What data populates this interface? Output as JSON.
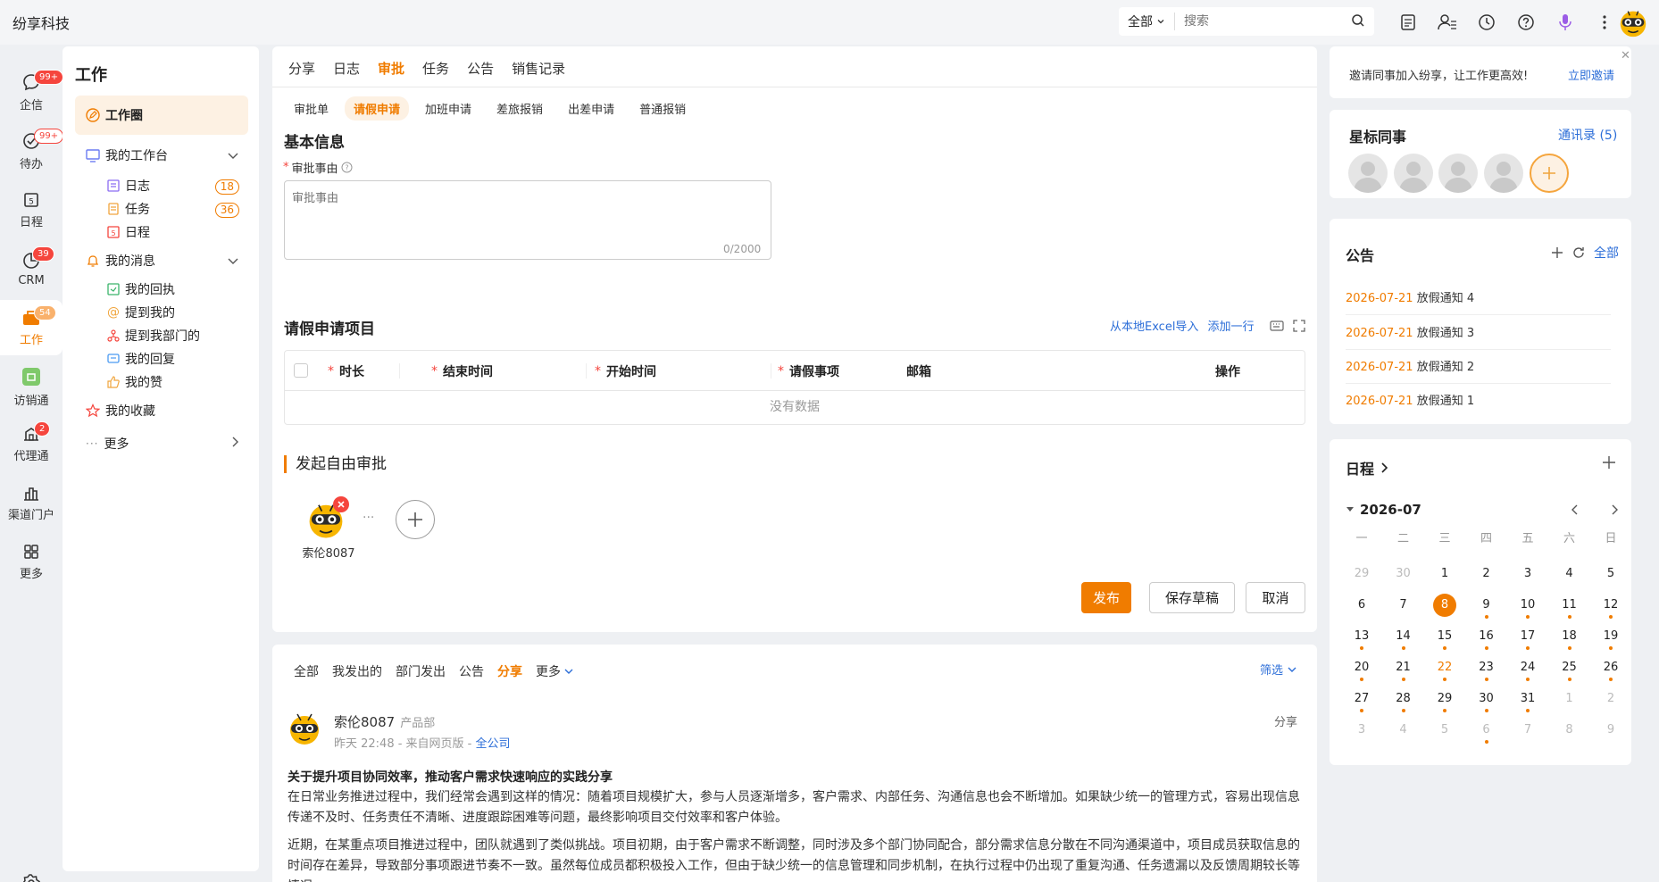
{
  "app": {
    "brand": "纷享科技"
  },
  "search": {
    "scope": "全部",
    "placeholder": "搜索"
  },
  "nav": [
    {
      "label": "企信",
      "badge": "99+"
    },
    {
      "label": "待办",
      "badge": "99+"
    },
    {
      "label": "日程",
      "badge": ""
    },
    {
      "label": "CRM",
      "badge": "39"
    },
    {
      "label": "工作",
      "badge": "54"
    },
    {
      "label": "访销通",
      "badge": ""
    },
    {
      "label": "代理通",
      "badge": "2"
    },
    {
      "label": "渠道门户",
      "badge": ""
    },
    {
      "label": "更多",
      "badge": ""
    }
  ],
  "sidebar": {
    "title": "工作",
    "circle": "工作圈",
    "workbench": "我的工作台",
    "log": "日志",
    "log_count": "18",
    "task": "任务",
    "task_count": "36",
    "schedule": "日程",
    "messages": "我的消息",
    "receipt": "我的回执",
    "mention": "提到我的",
    "mention_dept": "提到我部门的",
    "reply": "我的回复",
    "like": "我的赞",
    "favorites": "我的收藏",
    "more": "更多"
  },
  "tabs": [
    "分享",
    "日志",
    "审批",
    "任务",
    "公告",
    "销售记录"
  ],
  "subtabs": [
    "审批单",
    "请假申请",
    "加班申请",
    "差旅报销",
    "出差申请",
    "普通报销"
  ],
  "form": {
    "basic_title": "基本信息",
    "reason_label": "审批事由",
    "reason_placeholder": "审批事由",
    "char_count": "0/2000",
    "items_title": "请假申请项目",
    "import_excel": "从本地Excel导入",
    "add_row": "添加一行",
    "columns": [
      "时长",
      "结束时间",
      "开始时间",
      "请假事项",
      "邮箱",
      "操作"
    ],
    "empty": "没有数据",
    "free_title": "发起自由审批",
    "approver_name": "索伦8087",
    "ellipsis": "···",
    "publish": "发布",
    "save_draft": "保存草稿",
    "cancel": "取消"
  },
  "feed": {
    "tabs": [
      "全部",
      "我发出的",
      "部门发出",
      "公告",
      "分享"
    ],
    "more": "更多",
    "filter": "筛选",
    "author": "索伦8087",
    "dept": "产品部",
    "meta": "昨天 22:48 - 来自网页版 - ",
    "scope": "全公司",
    "type": "分享",
    "title": "关于提升项目协同效率，推动客户需求快速响应的实践分享",
    "p1": "在日常业务推进过程中，我们经常会遇到这样的情况：随着项目规模扩大，参与人员逐渐增多，客户需求、内部任务、沟通信息也会不断增加。如果缺少统一的管理方式，容易出现信息传递不及时、任务责任不清晰、进度跟踪困难等问题，最终影响项目交付效率和客户体验。",
    "p2": "近期，在某重点项目推进过程中，团队就遇到了类似挑战。项目初期，由于客户需求不断调整，同时涉及多个部门协同配合，部分需求信息分散在不同沟通渠道中，项目成员获取信息的时间存在差异，导致部分事项跟进节奏不一致。虽然每位成员都积极投入工作，但由于缺少统一的信息管理和同步机制，在执行过程中仍出现了重复沟通、任务遗漏以及反馈周期较长等情况。"
  },
  "invite": {
    "text": "邀请同事加入纷享，让工作更高效!",
    "link": "立即邀请"
  },
  "stars": {
    "title": "星标同事",
    "contacts": "通讯录 (5)"
  },
  "notices": {
    "title": "公告",
    "all": "全部",
    "items": [
      {
        "date": "2026-07-21",
        "text": "放假通知 4"
      },
      {
        "date": "2026-07-21",
        "text": "放假通知 3"
      },
      {
        "date": "2026-07-21",
        "text": "放假通知 2"
      },
      {
        "date": "2026-07-21",
        "text": "放假通知 1"
      }
    ]
  },
  "schedule": {
    "title": "日程",
    "month": "2026-07",
    "weekdays": [
      "一",
      "二",
      "三",
      "四",
      "五",
      "六",
      "日"
    ],
    "days": [
      {
        "d": "29",
        "s": "dim",
        "dot": false
      },
      {
        "d": "30",
        "s": "dim",
        "dot": false
      },
      {
        "d": "1",
        "s": "",
        "dot": false
      },
      {
        "d": "2",
        "s": "",
        "dot": false
      },
      {
        "d": "3",
        "s": "",
        "dot": false
      },
      {
        "d": "4",
        "s": "",
        "dot": false
      },
      {
        "d": "5",
        "s": "",
        "dot": false
      },
      {
        "d": "6",
        "s": "",
        "dot": false
      },
      {
        "d": "7",
        "s": "",
        "dot": false
      },
      {
        "d": "8",
        "s": "today",
        "dot": false
      },
      {
        "d": "9",
        "s": "",
        "dot": true
      },
      {
        "d": "10",
        "s": "",
        "dot": true
      },
      {
        "d": "11",
        "s": "",
        "dot": true
      },
      {
        "d": "12",
        "s": "",
        "dot": true
      },
      {
        "d": "13",
        "s": "",
        "dot": true
      },
      {
        "d": "14",
        "s": "",
        "dot": true
      },
      {
        "d": "15",
        "s": "",
        "dot": true
      },
      {
        "d": "16",
        "s": "",
        "dot": true
      },
      {
        "d": "17",
        "s": "",
        "dot": true
      },
      {
        "d": "18",
        "s": "",
        "dot": true
      },
      {
        "d": "19",
        "s": "",
        "dot": true
      },
      {
        "d": "20",
        "s": "",
        "dot": true
      },
      {
        "d": "21",
        "s": "",
        "dot": true
      },
      {
        "d": "22",
        "s": "red",
        "dot": true
      },
      {
        "d": "23",
        "s": "",
        "dot": true
      },
      {
        "d": "24",
        "s": "",
        "dot": true
      },
      {
        "d": "25",
        "s": "",
        "dot": true
      },
      {
        "d": "26",
        "s": "",
        "dot": true
      },
      {
        "d": "27",
        "s": "",
        "dot": true
      },
      {
        "d": "28",
        "s": "",
        "dot": true
      },
      {
        "d": "29",
        "s": "",
        "dot": true
      },
      {
        "d": "30",
        "s": "",
        "dot": true
      },
      {
        "d": "31",
        "s": "",
        "dot": true
      },
      {
        "d": "1",
        "s": "dim",
        "dot": false
      },
      {
        "d": "2",
        "s": "dim",
        "dot": false
      },
      {
        "d": "3",
        "s": "dim",
        "dot": false
      },
      {
        "d": "4",
        "s": "dim",
        "dot": false
      },
      {
        "d": "5",
        "s": "dim",
        "dot": false
      },
      {
        "d": "6",
        "s": "dim",
        "dot": true
      },
      {
        "d": "7",
        "s": "dim",
        "dot": false
      },
      {
        "d": "8",
        "s": "dim",
        "dot": false
      },
      {
        "d": "9",
        "s": "dim",
        "dot": false
      }
    ]
  },
  "colors": {
    "accent": "#f07c00",
    "link": "#2c6ed8",
    "badge": "#f5453d"
  }
}
